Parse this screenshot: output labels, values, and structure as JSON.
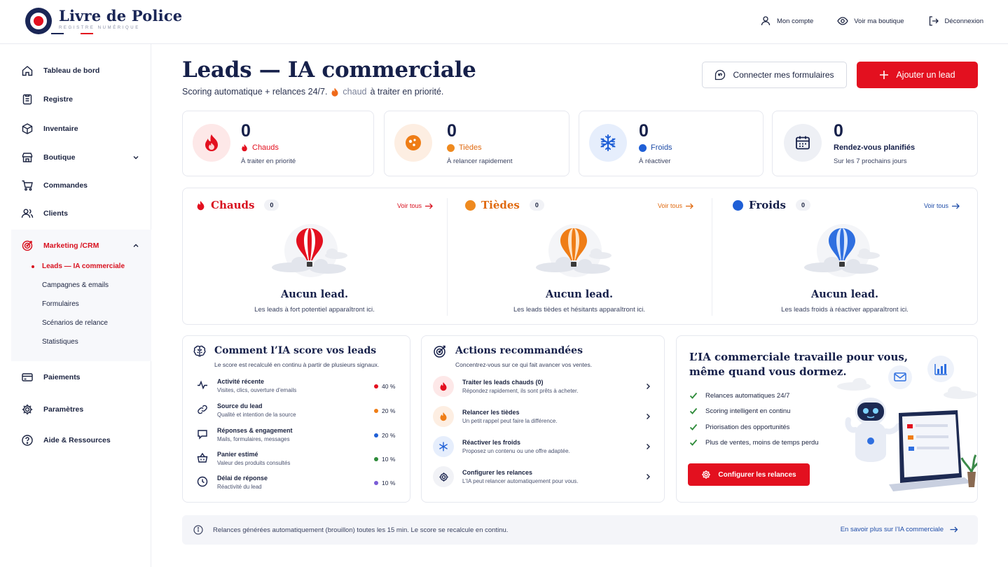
{
  "brand": {
    "title": "Livre de Police",
    "subtitle": "REGISTRE NUMÉRIQUE"
  },
  "topnav": {
    "account": "Mon compte",
    "shop": "Voir ma boutique",
    "logout": "Déconnexion"
  },
  "sidebar": {
    "items": [
      {
        "label": "Tableau de bord"
      },
      {
        "label": "Registre"
      },
      {
        "label": "Inventaire"
      },
      {
        "label": "Boutique"
      },
      {
        "label": "Commandes"
      },
      {
        "label": "Clients"
      },
      {
        "label": "Marketing /CRM"
      },
      {
        "label": "Paiements"
      },
      {
        "label": "Paramètres"
      },
      {
        "label": "Aide & Ressources"
      }
    ],
    "marketing_sub": [
      {
        "label": "Leads — IA commerciale"
      },
      {
        "label": "Campagnes & emails"
      },
      {
        "label": "Formulaires"
      },
      {
        "label": "Scénarios de relance"
      },
      {
        "label": "Statistiques"
      }
    ]
  },
  "header": {
    "title": "Leads — IA commerciale",
    "subtitle_before": "Scoring automatique + relances 24/7.",
    "subtitle_hot": "chaud",
    "subtitle_after": "à traiter en priorité.",
    "connect_button": "Connecter mes formulaires",
    "add_button": "Ajouter un lead"
  },
  "stats": [
    {
      "value": "0",
      "label": "Chauds",
      "desc": "À traiter en priorité"
    },
    {
      "value": "0",
      "label": "Tièdes",
      "desc": "À relancer rapidement"
    },
    {
      "value": "0",
      "label": "Froids",
      "desc": "À réactiver"
    },
    {
      "value": "0",
      "label": "Rendez-vous planifiés",
      "desc": "Sur les 7 prochains jours"
    }
  ],
  "columns": [
    {
      "title": "Chauds",
      "count": "0",
      "link": "Voir tous",
      "empty_title": "Aucun lead.",
      "empty_desc": "Les leads à fort potentiel apparaîtront ici."
    },
    {
      "title": "Tièdes",
      "count": "0",
      "link": "Voir tous",
      "empty_title": "Aucun lead.",
      "empty_desc": "Les leads tièdes et hésitants apparaîtront ici."
    },
    {
      "title": "Froids",
      "count": "0",
      "link": "Voir tous",
      "empty_title": "Aucun lead.",
      "empty_desc": "Les leads froids à réactiver apparaîtront ici."
    }
  ],
  "scoring": {
    "title": "Comment l’IA score vos leads",
    "subtitle": "Le score est recalculé en continu à partir de plusieurs signaux.",
    "signals": [
      {
        "title": "Activité récente",
        "desc": "Visites, clics, ouverture d’emails",
        "pct": "40 %"
      },
      {
        "title": "Source du lead",
        "desc": "Qualité et intention de la source",
        "pct": "20 %"
      },
      {
        "title": "Réponses & engagement",
        "desc": "Mails, formulaires, messages",
        "pct": "20 %"
      },
      {
        "title": "Panier estimé",
        "desc": "Valeur des produits consultés",
        "pct": "10 %"
      },
      {
        "title": "Délai de réponse",
        "desc": "Réactivité du lead",
        "pct": "10 %"
      }
    ]
  },
  "actions": {
    "title": "Actions recommandées",
    "subtitle": "Concentrez-vous sur ce qui fait avancer vos ventes.",
    "items": [
      {
        "title": "Traiter les leads chauds (0)",
        "desc": "Répondez rapidement, ils sont prêts à acheter."
      },
      {
        "title": "Relancer les tièdes",
        "desc": "Un petit rappel peut faire la différence."
      },
      {
        "title": "Réactiver les froids",
        "desc": "Proposez un contenu ou une offre adaptée."
      },
      {
        "title": "Configurer les relances",
        "desc": "L’IA peut relancer automatiquement pour vous."
      }
    ]
  },
  "promo": {
    "title_line1": "L’IA commerciale travaille pour vous,",
    "title_line2": "même quand vous dormez.",
    "features": [
      "Relances automatiques 24/7",
      "Scoring intelligent en continu",
      "Priorisation des opportunités",
      "Plus de ventes, moins de temps perdu"
    ],
    "button": "Configurer les relances"
  },
  "footer": {
    "info": "Relances générées automatiquement (brouillon) toutes les 15 min. Le score se recalcule en continu.",
    "link": "En savoir plus sur l’IA commerciale"
  },
  "colors": {
    "red": "#e3101f",
    "navy": "#16204a",
    "orange": "#ef7d16",
    "blue": "#1f5fd6"
  },
  "icons": [
    "home-icon",
    "register-icon",
    "box-icon",
    "store-icon",
    "cart-icon",
    "users-icon",
    "target-icon",
    "card-icon",
    "gear-icon",
    "help-icon",
    "flame-icon",
    "orange-ball-icon",
    "snowflake-icon",
    "calendar-icon",
    "balloon-icon",
    "brain-icon",
    "pulse-icon",
    "link-icon",
    "chat-icon",
    "basket-icon",
    "clock-icon",
    "robot-icon",
    "laptop-icon",
    "mail-icon",
    "chart-icon",
    "check-icon",
    "info-icon",
    "arrow-right-icon"
  ]
}
